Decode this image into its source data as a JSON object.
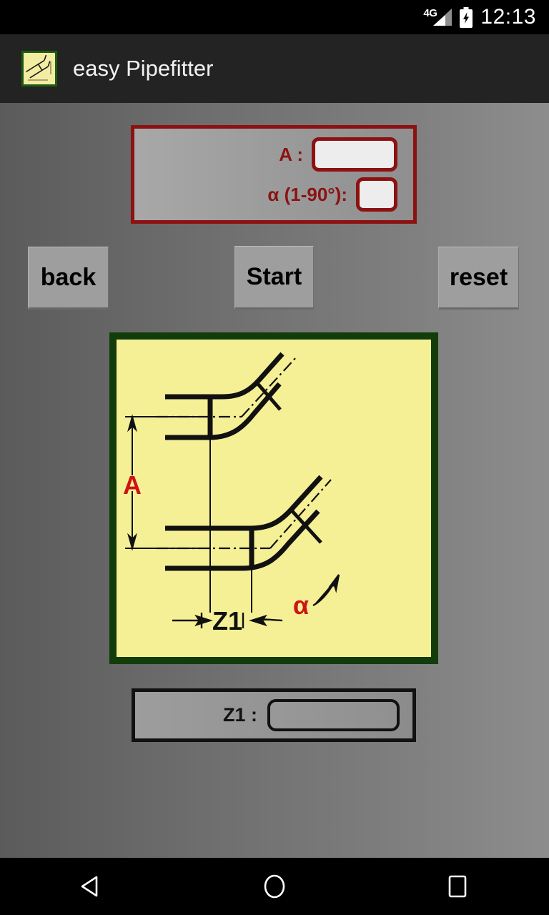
{
  "status_bar": {
    "network_label": "4G",
    "time": "12:13",
    "signal_icon": "signal-bars-icon",
    "battery_icon": "battery-charging-icon"
  },
  "app_bar": {
    "title": "easy Pipefitter",
    "icon": "app-logo-pipe-diagram-icon"
  },
  "input_panel": {
    "border_color": "#8c1212",
    "rows": [
      {
        "label": "A :",
        "value": "",
        "placeholder": "",
        "field": "big"
      },
      {
        "label": "α (1-90°):",
        "value": "",
        "placeholder": "",
        "field": "small"
      }
    ]
  },
  "buttons": {
    "back": "back",
    "start": "Start",
    "reset": "reset"
  },
  "diagram": {
    "border_color": "#123d0a",
    "background_color": "#f5f096",
    "label_color": "#cc1414",
    "labels": {
      "offset": "A",
      "travel": "Z1",
      "angle": "α"
    },
    "description": "Two parallel pipe runs each with an offset bend; vertical dimension A between centerlines, horizontal dimension Z1 between bend centers, angle alpha at the lower bend."
  },
  "result_panel": {
    "label": "Z1 :",
    "value": "",
    "border_color": "#111111"
  },
  "nav_bar": {
    "back_icon": "nav-back-triangle-icon",
    "home_icon": "nav-home-circle-icon",
    "recents_icon": "nav-recents-square-icon"
  }
}
